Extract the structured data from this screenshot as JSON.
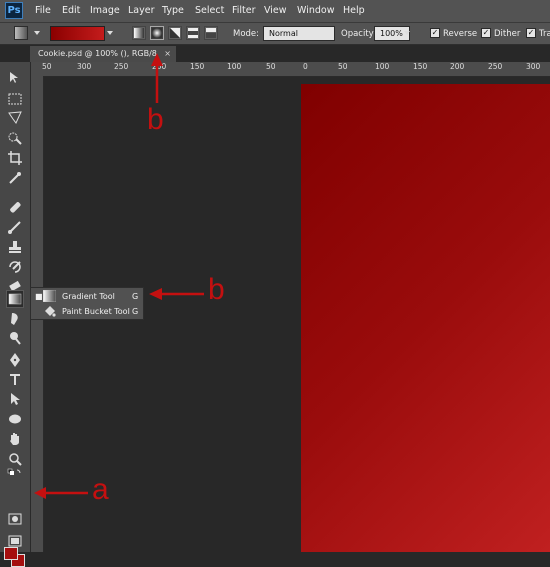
{
  "app": {
    "logo": "Ps"
  },
  "menu": [
    "File",
    "Edit",
    "Image",
    "Layer",
    "Type",
    "Select",
    "Filter",
    "View",
    "Window",
    "Help"
  ],
  "options": {
    "mode_label": "Mode:",
    "mode_value": "Normal",
    "opacity_label": "Opacity:",
    "opacity_value": "100%",
    "reverse_label": "Reverse",
    "dither_label": "Dither",
    "transparency_label": "Tra",
    "gradient_types": [
      "linear",
      "radial",
      "angle",
      "reflected",
      "diamond"
    ],
    "active_gradient_type": "radial"
  },
  "document": {
    "tab_title": "Cookie.psd @ 100% (), RGB/8",
    "close_glyph": "×"
  },
  "ruler_top": [
    "50",
    "300",
    "250",
    "200",
    "150",
    "100",
    "50",
    "0",
    "50",
    "100",
    "150",
    "200",
    "250",
    "300"
  ],
  "flyout": {
    "items": [
      {
        "label": "Gradient Tool",
        "shortcut": "G",
        "active_marker": "■"
      },
      {
        "label": "Paint Bucket Tool",
        "shortcut": "G",
        "active_marker": ""
      }
    ]
  },
  "colors": {
    "foreground": "#a50e0e",
    "background": "#a50e0e",
    "canvas_from": "#800000",
    "canvas_to": "#c02020",
    "annotation": "#c41010"
  },
  "annotations": {
    "label_a": "a",
    "label_b_top": "b",
    "label_b_side": "b"
  }
}
